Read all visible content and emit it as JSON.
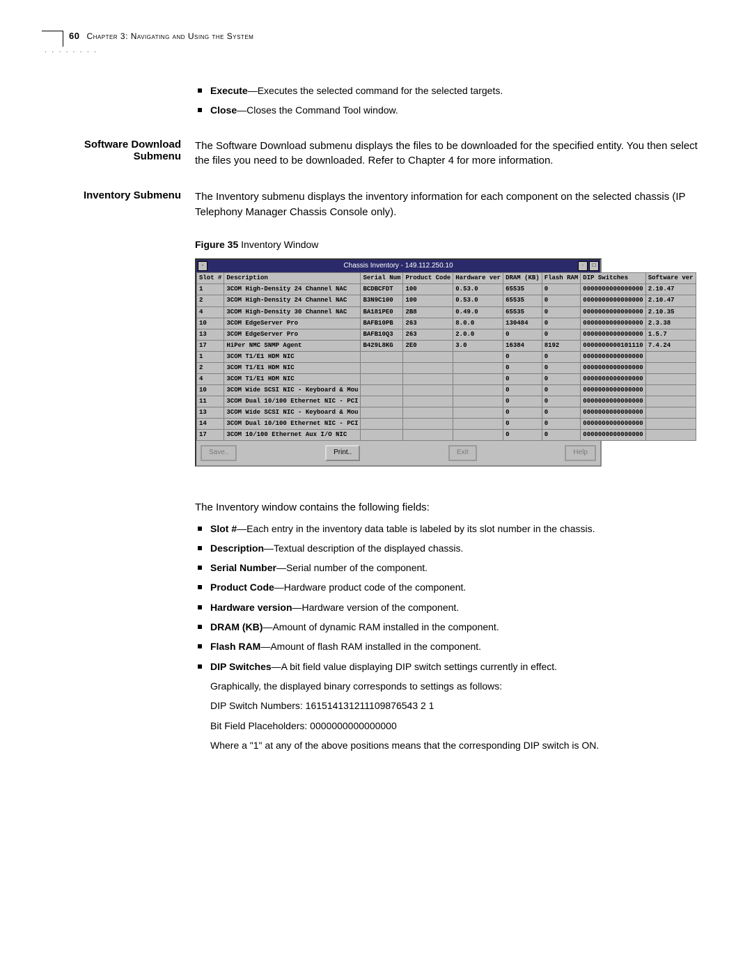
{
  "header": {
    "page_number": "60",
    "chapter": "Chapter 3: Navigating and Using the System"
  },
  "top_bullets": [
    {
      "term": "Execute",
      "desc": "—Executes the selected command for the selected targets."
    },
    {
      "term": "Close",
      "desc": "—Closes the Command Tool window."
    }
  ],
  "sections": [
    {
      "label": "Software Download Submenu",
      "body": "The Software Download submenu displays the files to be downloaded for the specified entity. You then select the files you need to be downloaded. Refer to Chapter 4 for more information."
    },
    {
      "label": "Inventory Submenu",
      "body": "The Inventory submenu displays the inventory information for each component on the selected chassis (IP Telephony Manager Chassis Console only)."
    }
  ],
  "figure": {
    "caption_bold": "Figure 35",
    "caption_rest": "  Inventory Window",
    "window_title": "Chassis Inventory - 149.112.250.10",
    "headers": [
      "Slot #",
      "Description",
      "Serial Num",
      "Product Code",
      "Hardware ver",
      "DRAM (KB)",
      "Flash RAM",
      "DIP Switches",
      "Software ver"
    ],
    "rows": [
      [
        "1",
        "3COM High-Density 24 Channel NAC",
        "BCDBCFDT",
        "100",
        "0.53.0",
        "65535",
        "0",
        "0000000000000000",
        "2.10.47"
      ],
      [
        "2",
        "3COM High-Density 24 Channel NAC",
        "B3N9C100",
        "100",
        "0.53.0",
        "65535",
        "0",
        "0000000000000000",
        "2.10.47"
      ],
      [
        "4",
        "3COM High-Density 30 Channel NAC",
        "BA181PE0",
        "2B8",
        "0.49.0",
        "65535",
        "0",
        "0000000000000000",
        "2.10.35"
      ],
      [
        "10",
        "3COM EdgeServer Pro",
        "BAFB10PB",
        "263",
        "8.0.0",
        "130484",
        "0",
        "0000000000000000",
        "2.3.38"
      ],
      [
        "13",
        "3COM EdgeServer Pro",
        "BAFB10Q3",
        "263",
        "2.0.0",
        "0",
        "0",
        "0000000000000000",
        "1.5.7"
      ],
      [
        "17",
        "HiPer NMC SNMP Agent",
        "B429L8KG",
        "2E0",
        "3.0",
        "16384",
        "8192",
        "0000000000101110",
        "7.4.24"
      ],
      [
        "1",
        "3COM T1/E1 HDM NIC",
        "",
        "",
        "",
        "0",
        "0",
        "0000000000000000",
        ""
      ],
      [
        "2",
        "3COM T1/E1 HDM NIC",
        "",
        "",
        "",
        "0",
        "0",
        "0000000000000000",
        ""
      ],
      [
        "4",
        "3COM T1/E1 HDM NIC",
        "",
        "",
        "",
        "0",
        "0",
        "0000000000000000",
        ""
      ],
      [
        "10",
        "3COM Wide SCSI NIC - Keyboard & Mou",
        "",
        "",
        "",
        "0",
        "0",
        "0000000000000000",
        ""
      ],
      [
        "11",
        "3COM Dual 10/100 Ethernet NIC - PCI",
        "",
        "",
        "",
        "0",
        "0",
        "0000000000000000",
        ""
      ],
      [
        "13",
        "3COM Wide SCSI NIC - Keyboard & Mou",
        "",
        "",
        "",
        "0",
        "0",
        "0000000000000000",
        ""
      ],
      [
        "14",
        "3COM Dual 10/100 Ethernet NIC - PCI",
        "",
        "",
        "",
        "0",
        "0",
        "0000000000000000",
        ""
      ],
      [
        "17",
        "3COM 10/100 Ethernet Aux I/O NIC",
        "",
        "",
        "",
        "0",
        "0",
        "0000000000000000",
        ""
      ]
    ],
    "buttons": {
      "save": "Save..",
      "print": "Print..",
      "exit": "Exit",
      "help": "Help"
    }
  },
  "after_figure_intro": "The Inventory window contains the following fields:",
  "fields": [
    {
      "term": "Slot #",
      "desc": "—Each entry in the inventory data table is labeled by its slot number in the chassis."
    },
    {
      "term": "Description",
      "desc": "—Textual description of the displayed chassis."
    },
    {
      "term": "Serial Number",
      "desc": "—Serial number of the component."
    },
    {
      "term": "Product Code",
      "desc": "—Hardware product code of the component."
    },
    {
      "term": "Hardware version",
      "desc": "—Hardware version of the component."
    },
    {
      "term": "DRAM (KB)",
      "desc": "—Amount of dynamic RAM installed in the component."
    },
    {
      "term": "Flash RAM",
      "desc": "—Amount of flash RAM installed in the component."
    },
    {
      "term": "DIP Switches",
      "desc": "—A bit field value displaying DIP switch settings currently in effect."
    }
  ],
  "dip_extra": {
    "l1": "Graphically, the displayed binary corresponds to settings as follows:",
    "l2": "DIP Switch Numbers: 161514131211109876543 2 1",
    "l3": "Bit Field Placeholders: 0000000000000000",
    "l4": "Where a \"1\" at any of the above positions means that the corresponding DIP switch is ON."
  }
}
